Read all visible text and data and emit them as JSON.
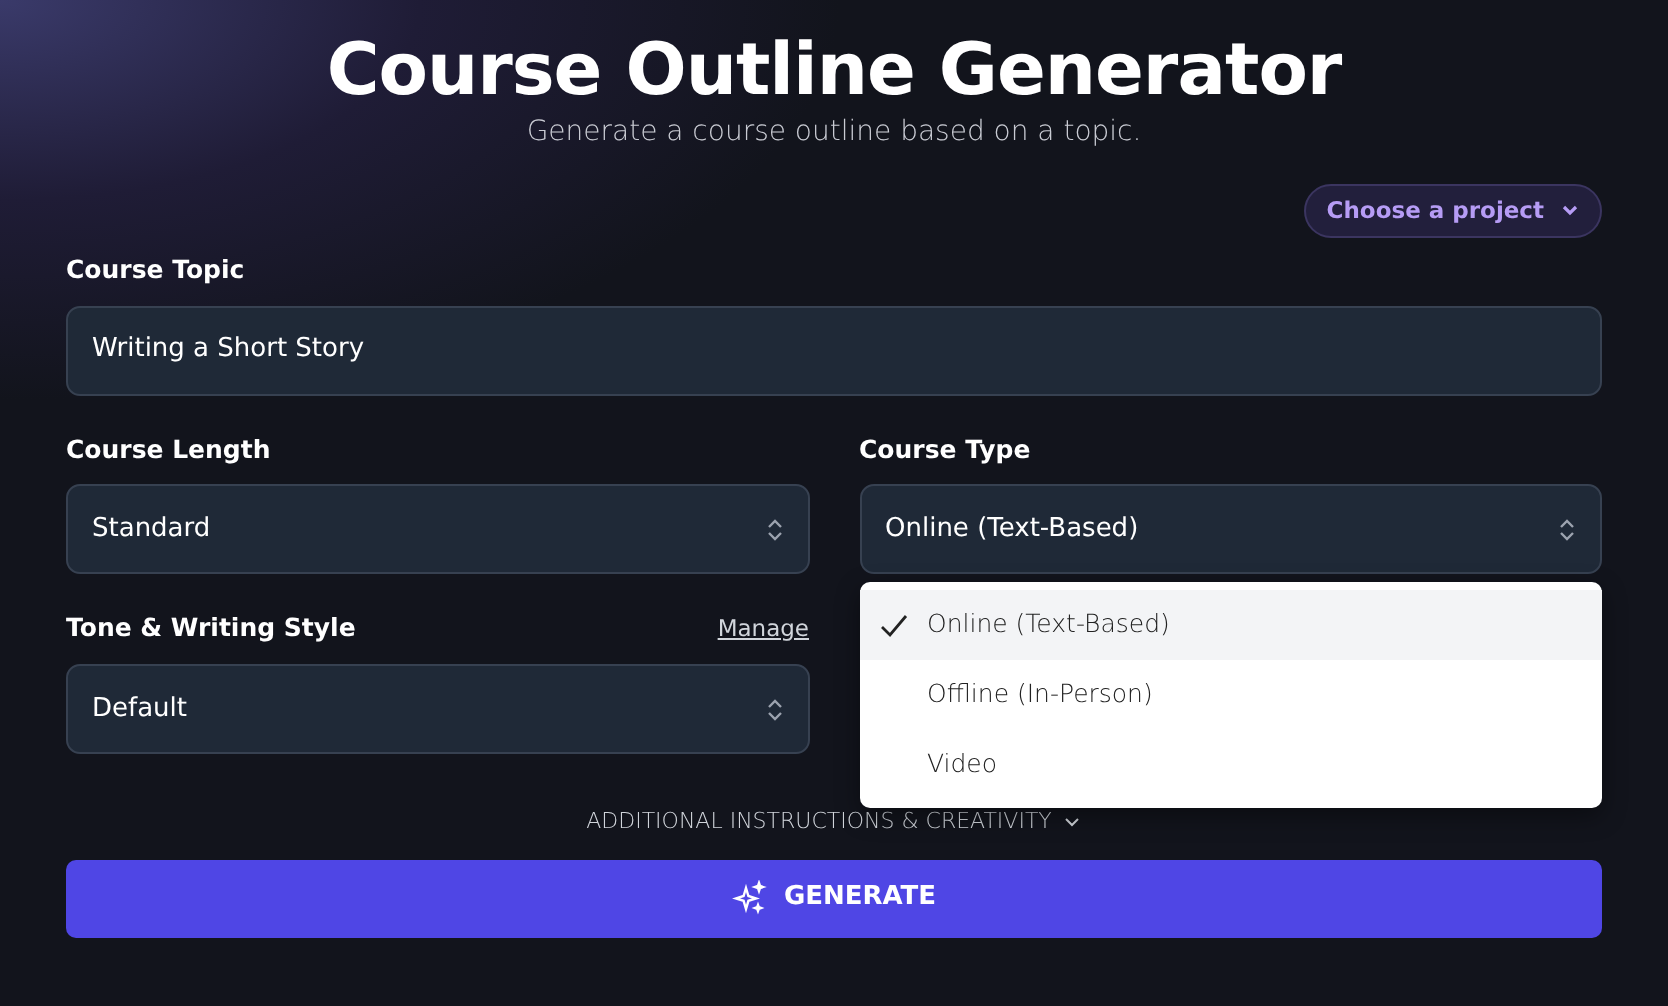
{
  "header": {
    "title": "Course Outline Generator",
    "subtitle": "Generate a course outline based on a topic."
  },
  "project_button": {
    "label": "Choose a project"
  },
  "topic": {
    "label": "Course Topic",
    "value": "Writing a Short Story"
  },
  "length": {
    "label": "Course Length",
    "value": "Standard"
  },
  "type": {
    "label": "Course Type",
    "value": "Online (Text-Based)",
    "expanded": true,
    "options": [
      {
        "label": "Online (Text-Based)",
        "selected": true
      },
      {
        "label": "Offline (In-Person)",
        "selected": false
      },
      {
        "label": "Video",
        "selected": false
      }
    ]
  },
  "tone": {
    "label": "Tone & Writing Style",
    "link": "Manage",
    "value": "Default"
  },
  "additional": {
    "label": "ADDITIONAL INSTRUCTIONS & CREATIVITY",
    "expanded": false
  },
  "generate_button": {
    "label": "GENERATE"
  }
}
